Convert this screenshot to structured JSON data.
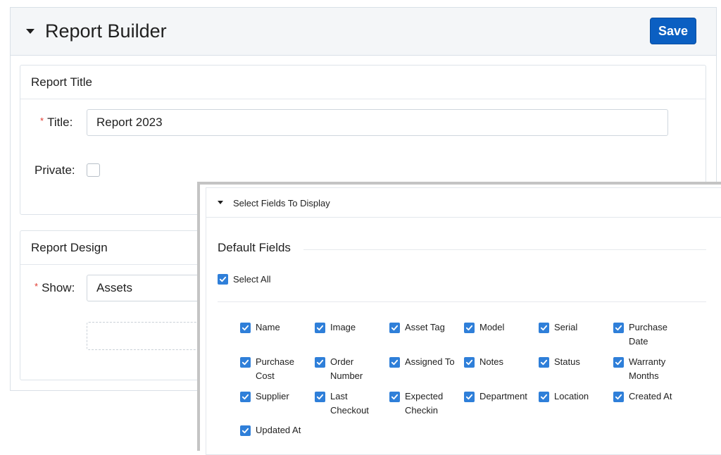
{
  "header": {
    "title": "Report Builder",
    "save_label": "Save"
  },
  "report_title_card": {
    "heading": "Report Title",
    "title_label": "Title",
    "required_mark": "*",
    "colon": ":",
    "title_value": "Report 2023",
    "private_label": "Private",
    "private_checked": false
  },
  "report_design_card": {
    "heading": "Report Design",
    "show_label": "Show",
    "show_value": "Assets"
  },
  "fields_panel": {
    "heading": "Select Fields To Display",
    "section_title": "Default Fields",
    "select_all_label": "Select All",
    "select_all_checked": true,
    "fields": [
      {
        "line1": "Name",
        "line2": "",
        "checked": true
      },
      {
        "line1": "Image",
        "line2": "",
        "checked": true
      },
      {
        "line1": "Asset Tag",
        "line2": "",
        "checked": true
      },
      {
        "line1": "Model",
        "line2": "",
        "checked": true
      },
      {
        "line1": "Serial",
        "line2": "",
        "checked": true
      },
      {
        "line1": "Purchase",
        "line2": "Date",
        "checked": true
      },
      {
        "line1": "Purchase",
        "line2": "Cost",
        "checked": true
      },
      {
        "line1": "Order",
        "line2": "Number",
        "checked": true
      },
      {
        "line1": "Assigned To",
        "line2": "",
        "checked": true
      },
      {
        "line1": "Notes",
        "line2": "",
        "checked": true
      },
      {
        "line1": "Status",
        "line2": "",
        "checked": true
      },
      {
        "line1": "Warranty",
        "line2": "Months",
        "checked": true
      },
      {
        "line1": "Supplier",
        "line2": "",
        "checked": true
      },
      {
        "line1": "Last",
        "line2": "Checkout",
        "checked": true
      },
      {
        "line1": "Expected",
        "line2": "Checkin",
        "checked": true
      },
      {
        "line1": "Department",
        "line2": "",
        "checked": true
      },
      {
        "line1": "Location",
        "line2": "",
        "checked": true
      },
      {
        "line1": "Created At",
        "line2": "",
        "checked": true
      },
      {
        "line1": "Updated At",
        "line2": "",
        "checked": true
      }
    ]
  },
  "colors": {
    "primary": "#0b5fc2",
    "checkbox": "#2f7fd9",
    "required": "#e0392f"
  },
  "icons": [
    "caret-down-icon",
    "checkmark-icon"
  ]
}
